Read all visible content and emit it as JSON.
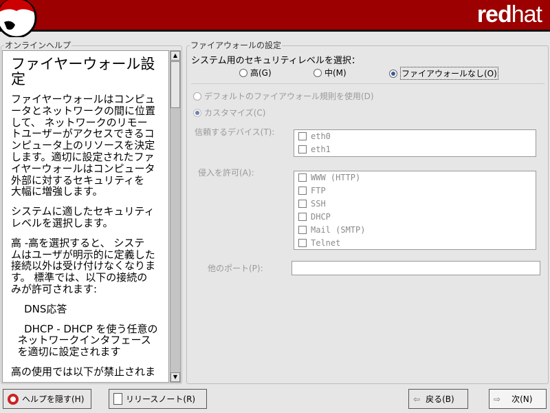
{
  "header": {
    "brand_bold": "red",
    "brand_light": "hat",
    "brand_color": "#9c0000"
  },
  "help": {
    "frame_label": "オンラインヘルプ",
    "title_lines": [
      "ファイヤーウォール設",
      "定"
    ],
    "paragraphs": [
      "ファイヤーウォールはコンピュ\nータとネットワークの間に位置\nして、 ネットワークのリモー\nトユーザーがアクセスできるコ\nンピュータ上のリソースを決定\nします。適切に設定されたファ\nイヤーウォールはコンピュータ\n外部に対するセキュリティを\n大幅に増強します。",
      "システムに適したセキュリティ\nレベルを選択します。",
      "高 -高を選択すると、 システ\nムはユーザが明示的に定義した\n接続以外は受け付けなくなりま\nす。 標準では、以下の接続の\nみが許可されます:",
      "    DNS応答",
      "    DHCP - DHCP を使う任意の\n  ネットワークインタフェース\n  を適切に設定されます",
      "高の使用では以下が禁止されま"
    ]
  },
  "firewall": {
    "frame_label": "ファイアウォールの設定",
    "level_prompt": "システム用のセキュリティレベルを選択：",
    "levels": [
      {
        "label": "高(G)",
        "selected": false
      },
      {
        "label": "中(M)",
        "selected": false
      },
      {
        "label": "ファイアウォールなし(O)",
        "selected": true
      }
    ],
    "default_rules": "デフォルトのファイアウォール規則を使用(D)",
    "customize": "カスタマイズ(C)",
    "customize_selected": true,
    "trusted_label": "信頼するデバイス(T):",
    "trusted_devices": [
      "eth0",
      "eth1"
    ],
    "allow_label": "侵入を許可(A):",
    "allow_services": [
      "WWW (HTTP)",
      "FTP",
      "SSH",
      "DHCP",
      "Mail (SMTP)",
      "Telnet"
    ],
    "other_ports_label": "他のポート(P):",
    "other_ports_value": ""
  },
  "buttons": {
    "hide_help": "ヘルプを隠す(H)",
    "release_notes": "リリースノート(R)",
    "back": "戻る(B)",
    "next": "次(N)"
  }
}
